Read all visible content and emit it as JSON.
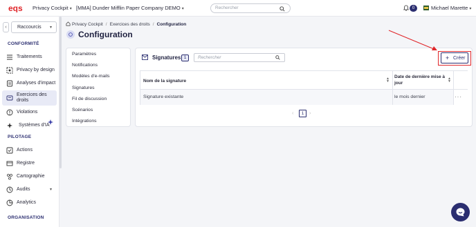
{
  "header": {
    "app_switcher": "Privacy Cockpit",
    "company_switcher": "[MMA] Dunder Mifflin Paper Company DEMO",
    "search_placeholder": "Rechercher",
    "notifications_count": "0",
    "user_name": "Michael Marette"
  },
  "sidebar": {
    "shortcuts_label": "Raccourcis",
    "sections": {
      "conformite": "CONFORMITÉ",
      "pilotage": "PILOTAGE",
      "organisation": "ORGANISATION"
    },
    "items": [
      {
        "label": "Traitements",
        "icon": "list-icon"
      },
      {
        "label": "Privacy by design",
        "icon": "privacy-design-icon"
      },
      {
        "label": "Analyses d'impact",
        "icon": "impact-icon"
      },
      {
        "label": "Exercices des droits",
        "icon": "rights-icon",
        "active": true
      },
      {
        "label": "Violations",
        "icon": "violation-icon"
      },
      {
        "label": "Systèmes d'IA",
        "icon": "ai-icon"
      },
      {
        "label": "Actions",
        "icon": "actions-icon"
      },
      {
        "label": "Registre",
        "icon": "register-icon"
      },
      {
        "label": "Cartographie",
        "icon": "map-icon"
      },
      {
        "label": "Audits",
        "icon": "audit-icon"
      },
      {
        "label": "Analytics",
        "icon": "analytics-icon"
      }
    ]
  },
  "breadcrumb": {
    "items": [
      "Privacy Cockpit",
      "Exercices des droits",
      "Configuration"
    ],
    "separator": "/"
  },
  "page": {
    "title": "Configuration"
  },
  "config_menu": {
    "items": [
      "Paramètres",
      "Notifications",
      "Modèles d'e-mails",
      "Signatures",
      "Fil de discussion",
      "Scénarios",
      "Intégrations"
    ]
  },
  "signatures": {
    "title": "Signatures",
    "count": "1",
    "search_placeholder": "Rechercher",
    "create_label": "Créer",
    "columns": [
      "Nom de la signature",
      "Date de dernière mise à jour"
    ],
    "rows": [
      {
        "name": "Signature existante",
        "updated": "le mois dernier"
      }
    ],
    "pagination": {
      "current": "1"
    }
  },
  "colors": {
    "accent": "#2b2e70",
    "highlight": "#e0262a",
    "brand_logo": "#e0262a"
  }
}
